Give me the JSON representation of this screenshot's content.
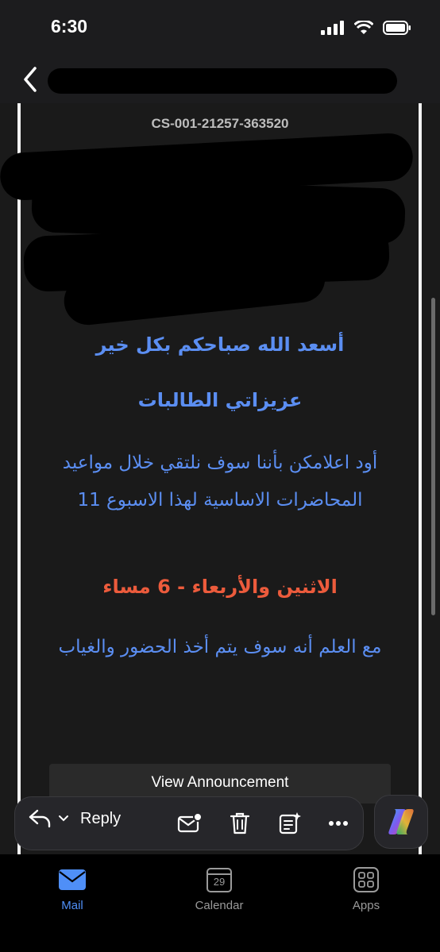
{
  "status_bar": {
    "time": "6:30"
  },
  "header": {
    "back_label": "back"
  },
  "message": {
    "case_id": "CS-001-21257-363520",
    "greeting": "أسعد الله صباحكم بكل خير",
    "addressee": "عزيزاتي الطالبات",
    "notice": "أود اعلامكن بأننا سوف نلتقي خلال مواعيد المحاضرات الاساسية لهذا الاسبوع 11",
    "days": "الاثنين والأربعاء - 6 مساء",
    "attendance_note": "مع العلم أنه سوف يتم أخذ الحضور والغياب",
    "view_button": "View Announcement"
  },
  "actions": {
    "reply_label": "Reply",
    "icons": [
      "reply-icon",
      "chevron-down-icon",
      "mark-unread-icon",
      "trash-icon",
      "summarize-icon",
      "more-icon",
      "copilot-icon"
    ]
  },
  "tabs": [
    {
      "label": "Mail",
      "icon": "mail-icon",
      "active": true
    },
    {
      "label": "Calendar",
      "icon": "calendar-icon",
      "day": "29",
      "active": false
    },
    {
      "label": "Apps",
      "icon": "apps-icon",
      "active": false
    }
  ],
  "colors": {
    "accent": "#4f8ff7",
    "arabic_blue": "#5b8ef2",
    "highlight_red": "#ec5b3c"
  }
}
